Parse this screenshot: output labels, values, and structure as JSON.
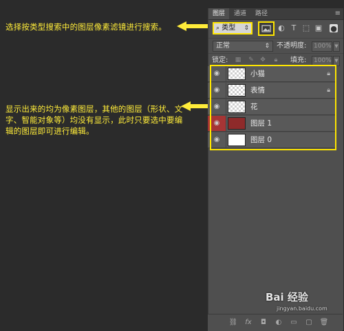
{
  "annotations": {
    "top": "选择按类型搜索中的图层像素滤镜进行搜索。",
    "middle": "显示出来的均为像素图层，其他的图层（形状、文字、智能对象等）均没有显示，此时只要选中要编辑的图层即可进行编辑。"
  },
  "panel": {
    "tabs": [
      "图层",
      "通道",
      "路径"
    ],
    "active_tab": "图层",
    "menu_icon": "panel-menu-icon",
    "filter": {
      "kind_label": "类型",
      "search_icon": "search-icon"
    },
    "blend_mode": "正常",
    "opacity_label": "不透明度:",
    "opacity_value": "100%",
    "lock_label": "锁定:",
    "fill_label": "填充:",
    "fill_value": "100%"
  },
  "layers": [
    {
      "name": "小猫",
      "locked": true,
      "thumb": "checker"
    },
    {
      "name": "表情",
      "locked": true,
      "thumb": "checker"
    },
    {
      "name": "花",
      "locked": false,
      "thumb": "checker"
    },
    {
      "name": "图层 1",
      "locked": false,
      "thumb": "red"
    },
    {
      "name": "图层 0",
      "locked": false,
      "thumb": "white"
    }
  ],
  "watermark": {
    "text": "Bai 经验",
    "sub": "jingyan.baidu.com"
  },
  "colors": {
    "annotation": "#ffec3a",
    "highlight": "#ffe600",
    "layer_red": "#8e2a2a"
  }
}
